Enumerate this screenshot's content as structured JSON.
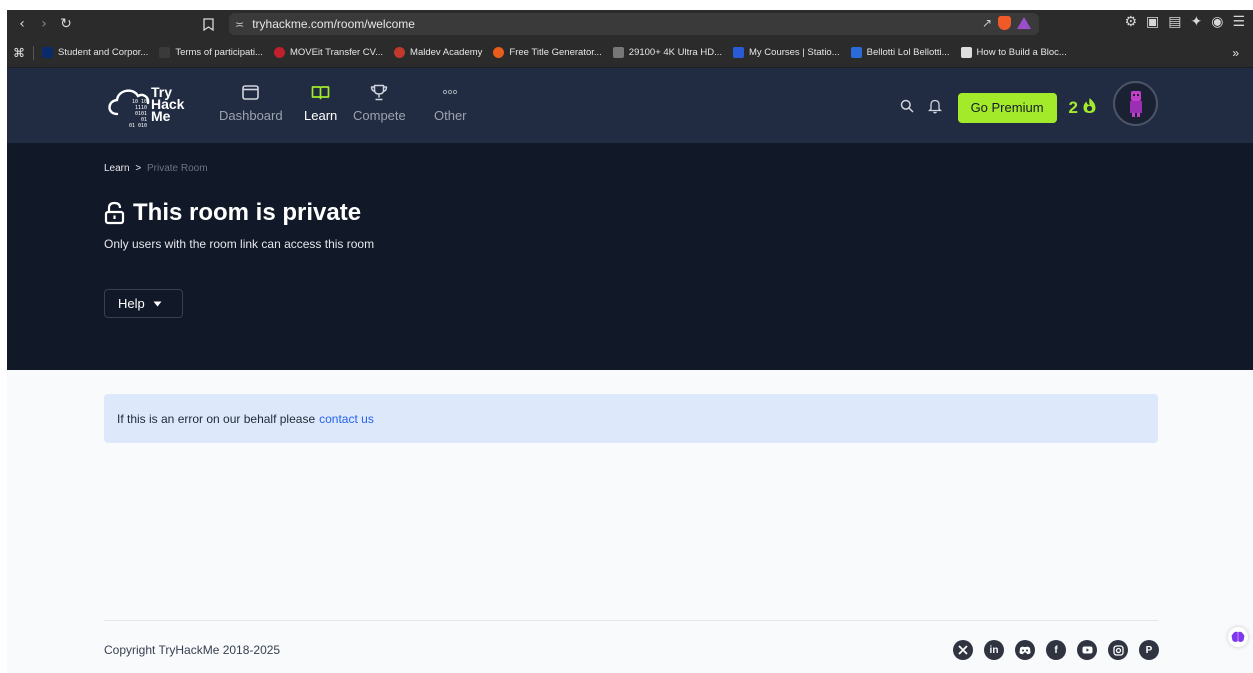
{
  "browser": {
    "url": "tryhackme.com/room/welcome",
    "bookmarks": [
      {
        "label": "Student and Corpor...",
        "color": "#0a2a6b"
      },
      {
        "label": "Terms of participati...",
        "color": "#3a3a3a"
      },
      {
        "label": "MOVEit Transfer CV...",
        "color": "#c0202c"
      },
      {
        "label": "Maldev Academy",
        "color": "#c0392b"
      },
      {
        "label": "Free Title Generator...",
        "color": "#e85d1a"
      },
      {
        "label": "29100+ 4K Ultra HD...",
        "color": "#777777"
      },
      {
        "label": "My Courses | Statio...",
        "color": "#2a5bd7"
      },
      {
        "label": "Bellotti Lol Bellotti...",
        "color": "#2a6bd7"
      },
      {
        "label": "How to Build a Bloc...",
        "color": "#dddddd"
      }
    ],
    "bookmark_overflow": "»"
  },
  "header": {
    "logo_lines": [
      "Try",
      "Hack",
      "Me"
    ],
    "logo_digits": [
      "10 10",
      "1110",
      "0101 01",
      "01 010"
    ],
    "nav": [
      {
        "label": "Dashboard",
        "icon": "window-icon"
      },
      {
        "label": "Learn",
        "icon": "book-icon"
      },
      {
        "label": "Compete",
        "icon": "trophy-icon"
      },
      {
        "label": "Other",
        "icon": "dots-icon"
      }
    ],
    "premium_label": "Go Premium",
    "streak": "2",
    "accent": "#a3ea2a",
    "background": "#212c42"
  },
  "hero": {
    "breadcrumb_root": "Learn",
    "breadcrumb_sep": ">",
    "breadcrumb_current": "Private Room",
    "title": "This room is private",
    "subtitle": "Only users with the room link can access this room",
    "help_label": "Help",
    "background": "#111827"
  },
  "notice": {
    "text": "If this is an error on our behalf please",
    "link": "contact us"
  },
  "footer": {
    "copyright": "Copyright TryHackMe 2018-2025",
    "socials": [
      "x-icon",
      "linkedin-icon",
      "discord-icon",
      "facebook-icon",
      "youtube-icon",
      "instagram-icon",
      "pinterest-icon"
    ]
  }
}
